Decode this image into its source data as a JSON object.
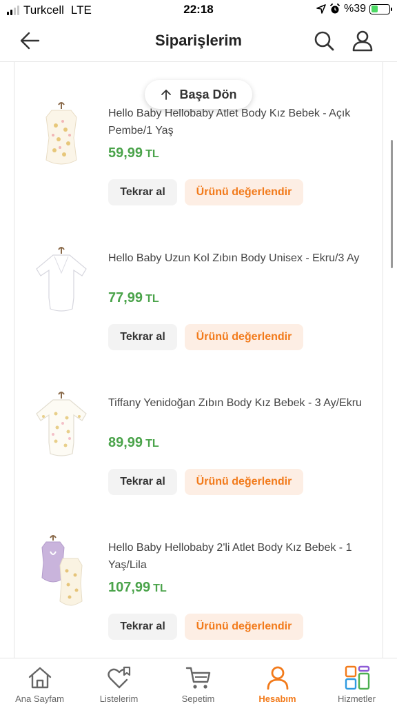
{
  "status_bar": {
    "carrier": "Turkcell",
    "network": "LTE",
    "time": "22:18",
    "battery": "%39",
    "battery_level": 0.39
  },
  "header": {
    "title": "Siparişlerim",
    "icons": [
      "back-arrow-icon",
      "search-icon",
      "user-icon"
    ]
  },
  "back_to_top": {
    "label": "Başa Dön",
    "icon": "arrow-up-icon"
  },
  "orders": [
    {
      "name": "Hello Baby Hellobaby Atlet Body Kız Bebek - Açık Pembe/1 Yaş",
      "price": "59,99",
      "currency": "TL",
      "reorder_label": "Tekrar al",
      "review_label": "Ürünü değerlendir"
    },
    {
      "name": "Hello Baby Uzun Kol Zıbın Body Unisex - Ekru/3 Ay",
      "price": "77,99",
      "currency": "TL",
      "reorder_label": "Tekrar al",
      "review_label": "Ürünü değerlendir"
    },
    {
      "name": "Tiffany Yenidoğan Zıbın Body Kız Bebek - 3 Ay/Ekru",
      "price": "89,99",
      "currency": "TL",
      "reorder_label": "Tekrar al",
      "review_label": "Ürünü değerlendir"
    },
    {
      "name": "Hello Baby Hellobaby 2'li Atlet Body Kız Bebek - 1 Yaş/Lila",
      "price": "107,99",
      "currency": "TL",
      "reorder_label": "Tekrar al",
      "review_label": "Ürünü değerlendir"
    }
  ],
  "tabbar": {
    "tabs": [
      {
        "label": "Ana Sayfam",
        "icon": "home-icon"
      },
      {
        "label": "Listelerim",
        "icon": "heart-list-icon"
      },
      {
        "label": "Sepetim",
        "icon": "cart-icon"
      },
      {
        "label": "Hesabım",
        "icon": "account-icon",
        "active": true
      },
      {
        "label": "Hizmetler",
        "icon": "services-grid-icon"
      }
    ]
  },
  "colors": {
    "accent": "#f27a1a",
    "price_green": "#4aa34a",
    "review_bg": "#fdeee4",
    "reorder_bg": "#f3f3f3"
  }
}
